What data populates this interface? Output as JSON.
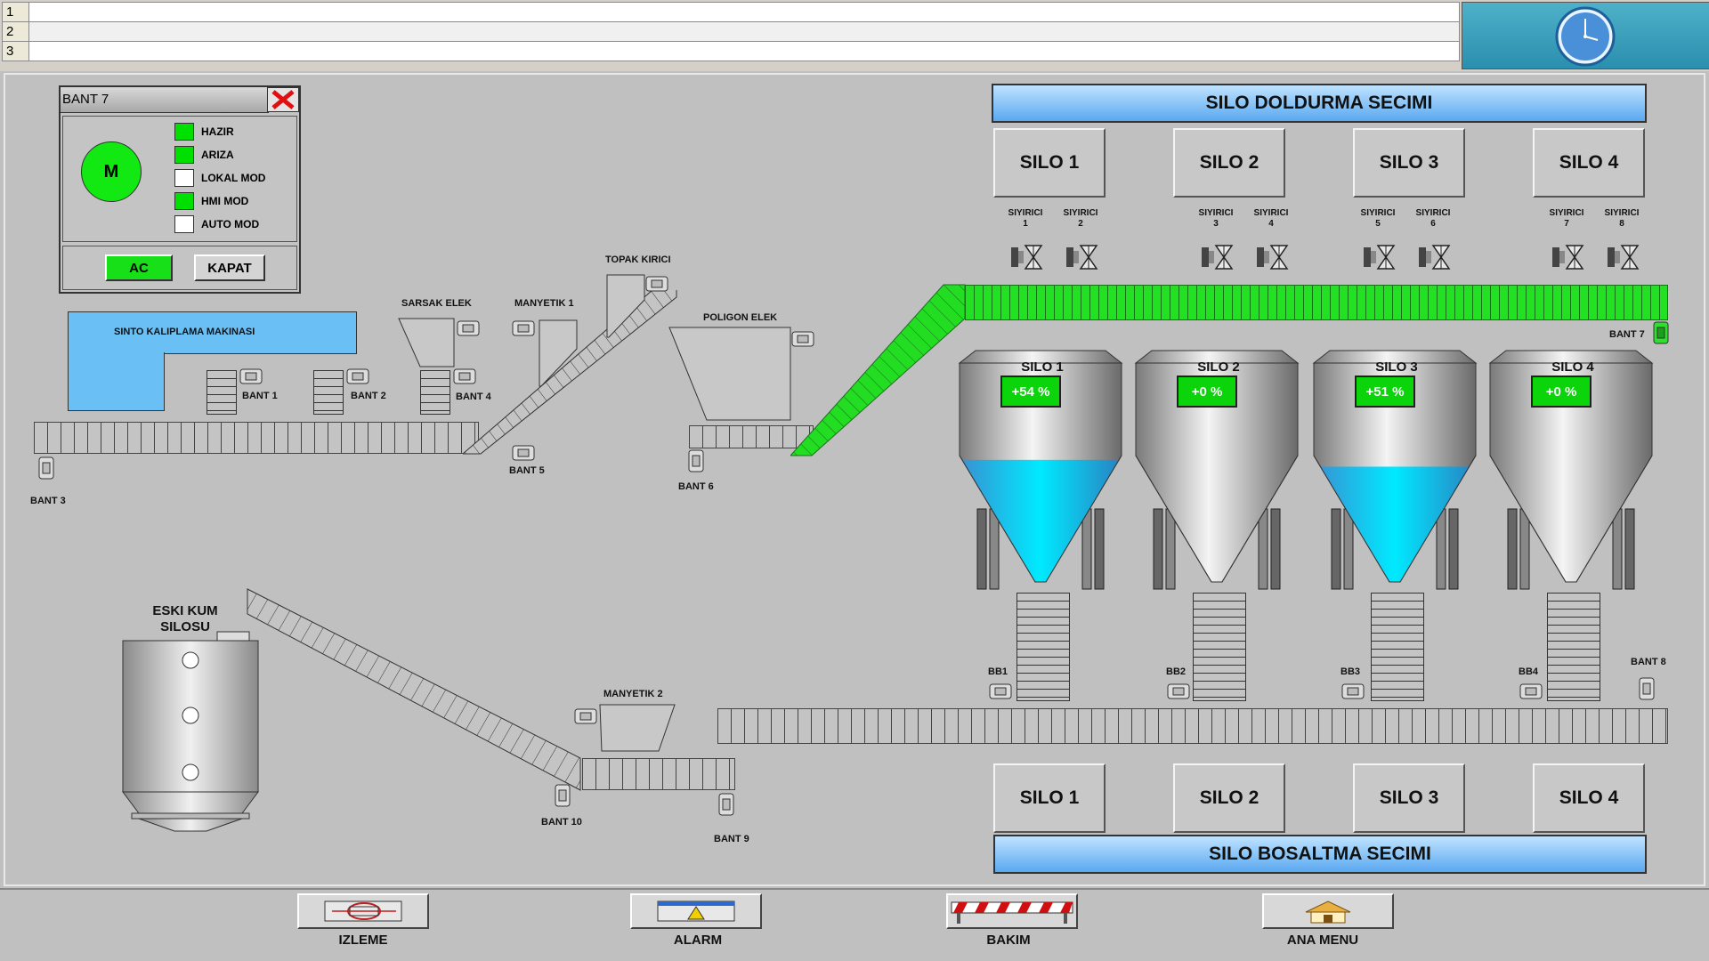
{
  "alarm_list": {
    "rows": [
      "1",
      "2",
      "3"
    ]
  },
  "clock": {
    "icon": "clock-icon"
  },
  "popup": {
    "title": "BANT 7",
    "motor_label": "M",
    "status_items": [
      {
        "label": "HAZIR",
        "state_color": "#00e000"
      },
      {
        "label": "ARIZA",
        "state_color": "#00e000"
      },
      {
        "label": "LOKAL MOD",
        "state_color": "#ffffff"
      },
      {
        "label": "HMI MOD",
        "state_color": "#00e000"
      },
      {
        "label": "AUTO MOD",
        "state_color": "#ffffff"
      }
    ],
    "open_label": "AC",
    "close_label": "KAPAT"
  },
  "plant": {
    "sinto": "SINTO KALIPLAMA MAKINASI",
    "sarsak": "SARSAK ELEK",
    "manyetik1": "MANYETIK 1",
    "topak": "TOPAK KIRICI",
    "poligon": "POLIGON ELEK",
    "manyetik2": "MANYETIK 2",
    "eski_kum": "ESKI KUM SILOSU",
    "bant1": "BANT 1",
    "bant2": "BANT 2",
    "bant3": "BANT 3",
    "bant4": "BANT 4",
    "bant5": "BANT 5",
    "bant6": "BANT 6",
    "bant7": "BANT 7",
    "bant8": "BANT 8",
    "bant9": "BANT 9",
    "bant10": "BANT 10",
    "bb1": "BB1",
    "bb2": "BB2",
    "bb3": "BB3",
    "bb4": "BB4"
  },
  "fill_select": {
    "title": "SILO DOLDURMA SECIMI",
    "buttons": [
      "SILO 1",
      "SILO 2",
      "SILO 3",
      "SILO 4"
    ]
  },
  "empty_select": {
    "title": "SILO BOSALTMA SECIMI",
    "buttons": [
      "SILO 1",
      "SILO 2",
      "SILO 3",
      "SILO 4"
    ]
  },
  "scrapers": [
    {
      "name": "SIYIRICI",
      "num": "1"
    },
    {
      "name": "SIYIRICI",
      "num": "2"
    },
    {
      "name": "SIYIRICI",
      "num": "3"
    },
    {
      "name": "SIYIRICI",
      "num": "4"
    },
    {
      "name": "SIYIRICI",
      "num": "5"
    },
    {
      "name": "SIYIRICI",
      "num": "6"
    },
    {
      "name": "SIYIRICI",
      "num": "7"
    },
    {
      "name": "SIYIRICI",
      "num": "8"
    }
  ],
  "silos": [
    {
      "name": "SILO 1",
      "level_text": "+54 %",
      "level": 0.54,
      "filled": true
    },
    {
      "name": "SILO 2",
      "level_text": "+0 %",
      "level": 0.0,
      "filled": false
    },
    {
      "name": "SILO 3",
      "level_text": "+51 %",
      "level": 0.51,
      "filled": true
    },
    {
      "name": "SILO 4",
      "level_text": "+0 %",
      "level": 0.0,
      "filled": false
    }
  ],
  "nav": {
    "izleme": "IZLEME",
    "alarm": "ALARM",
    "bakim": "BAKIM",
    "ana_menu": "ANA MENU"
  },
  "colors": {
    "active_green": "#00e000",
    "silo_fill": "#00eaff",
    "header_blue": "#5aa8f0"
  }
}
